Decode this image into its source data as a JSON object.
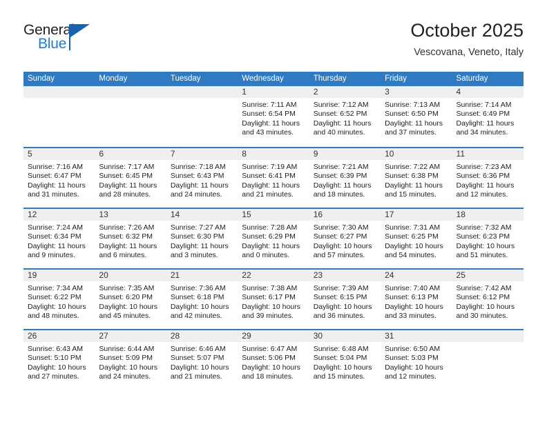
{
  "brand": {
    "word_one": "General",
    "word_two": "Blue",
    "logo_icon": "triangle-flag-icon",
    "color_dark": "#231f20",
    "color_blue": "#1a7fd4"
  },
  "header": {
    "title": "October 2025",
    "subtitle": "Vescovana, Veneto, Italy"
  },
  "theme": {
    "header_blue": "#2f7ac0",
    "daynum_band": "#efefef",
    "text": "#1d1d1d"
  },
  "calendar": {
    "weekday_headers": [
      "Sunday",
      "Monday",
      "Tuesday",
      "Wednesday",
      "Thursday",
      "Friday",
      "Saturday"
    ],
    "weeks": [
      [
        {
          "day": "",
          "lines": []
        },
        {
          "day": "",
          "lines": []
        },
        {
          "day": "",
          "lines": []
        },
        {
          "day": "1",
          "lines": [
            "Sunrise: 7:11 AM",
            "Sunset: 6:54 PM",
            "Daylight: 11 hours",
            "and 43 minutes."
          ]
        },
        {
          "day": "2",
          "lines": [
            "Sunrise: 7:12 AM",
            "Sunset: 6:52 PM",
            "Daylight: 11 hours",
            "and 40 minutes."
          ]
        },
        {
          "day": "3",
          "lines": [
            "Sunrise: 7:13 AM",
            "Sunset: 6:50 PM",
            "Daylight: 11 hours",
            "and 37 minutes."
          ]
        },
        {
          "day": "4",
          "lines": [
            "Sunrise: 7:14 AM",
            "Sunset: 6:49 PM",
            "Daylight: 11 hours",
            "and 34 minutes."
          ]
        }
      ],
      [
        {
          "day": "5",
          "lines": [
            "Sunrise: 7:16 AM",
            "Sunset: 6:47 PM",
            "Daylight: 11 hours",
            "and 31 minutes."
          ]
        },
        {
          "day": "6",
          "lines": [
            "Sunrise: 7:17 AM",
            "Sunset: 6:45 PM",
            "Daylight: 11 hours",
            "and 28 minutes."
          ]
        },
        {
          "day": "7",
          "lines": [
            "Sunrise: 7:18 AM",
            "Sunset: 6:43 PM",
            "Daylight: 11 hours",
            "and 24 minutes."
          ]
        },
        {
          "day": "8",
          "lines": [
            "Sunrise: 7:19 AM",
            "Sunset: 6:41 PM",
            "Daylight: 11 hours",
            "and 21 minutes."
          ]
        },
        {
          "day": "9",
          "lines": [
            "Sunrise: 7:21 AM",
            "Sunset: 6:39 PM",
            "Daylight: 11 hours",
            "and 18 minutes."
          ]
        },
        {
          "day": "10",
          "lines": [
            "Sunrise: 7:22 AM",
            "Sunset: 6:38 PM",
            "Daylight: 11 hours",
            "and 15 minutes."
          ]
        },
        {
          "day": "11",
          "lines": [
            "Sunrise: 7:23 AM",
            "Sunset: 6:36 PM",
            "Daylight: 11 hours",
            "and 12 minutes."
          ]
        }
      ],
      [
        {
          "day": "12",
          "lines": [
            "Sunrise: 7:24 AM",
            "Sunset: 6:34 PM",
            "Daylight: 11 hours",
            "and 9 minutes."
          ]
        },
        {
          "day": "13",
          "lines": [
            "Sunrise: 7:26 AM",
            "Sunset: 6:32 PM",
            "Daylight: 11 hours",
            "and 6 minutes."
          ]
        },
        {
          "day": "14",
          "lines": [
            "Sunrise: 7:27 AM",
            "Sunset: 6:30 PM",
            "Daylight: 11 hours",
            "and 3 minutes."
          ]
        },
        {
          "day": "15",
          "lines": [
            "Sunrise: 7:28 AM",
            "Sunset: 6:29 PM",
            "Daylight: 11 hours",
            "and 0 minutes."
          ]
        },
        {
          "day": "16",
          "lines": [
            "Sunrise: 7:30 AM",
            "Sunset: 6:27 PM",
            "Daylight: 10 hours",
            "and 57 minutes."
          ]
        },
        {
          "day": "17",
          "lines": [
            "Sunrise: 7:31 AM",
            "Sunset: 6:25 PM",
            "Daylight: 10 hours",
            "and 54 minutes."
          ]
        },
        {
          "day": "18",
          "lines": [
            "Sunrise: 7:32 AM",
            "Sunset: 6:23 PM",
            "Daylight: 10 hours",
            "and 51 minutes."
          ]
        }
      ],
      [
        {
          "day": "19",
          "lines": [
            "Sunrise: 7:34 AM",
            "Sunset: 6:22 PM",
            "Daylight: 10 hours",
            "and 48 minutes."
          ]
        },
        {
          "day": "20",
          "lines": [
            "Sunrise: 7:35 AM",
            "Sunset: 6:20 PM",
            "Daylight: 10 hours",
            "and 45 minutes."
          ]
        },
        {
          "day": "21",
          "lines": [
            "Sunrise: 7:36 AM",
            "Sunset: 6:18 PM",
            "Daylight: 10 hours",
            "and 42 minutes."
          ]
        },
        {
          "day": "22",
          "lines": [
            "Sunrise: 7:38 AM",
            "Sunset: 6:17 PM",
            "Daylight: 10 hours",
            "and 39 minutes."
          ]
        },
        {
          "day": "23",
          "lines": [
            "Sunrise: 7:39 AM",
            "Sunset: 6:15 PM",
            "Daylight: 10 hours",
            "and 36 minutes."
          ]
        },
        {
          "day": "24",
          "lines": [
            "Sunrise: 7:40 AM",
            "Sunset: 6:13 PM",
            "Daylight: 10 hours",
            "and 33 minutes."
          ]
        },
        {
          "day": "25",
          "lines": [
            "Sunrise: 7:42 AM",
            "Sunset: 6:12 PM",
            "Daylight: 10 hours",
            "and 30 minutes."
          ]
        }
      ],
      [
        {
          "day": "26",
          "lines": [
            "Sunrise: 6:43 AM",
            "Sunset: 5:10 PM",
            "Daylight: 10 hours",
            "and 27 minutes."
          ]
        },
        {
          "day": "27",
          "lines": [
            "Sunrise: 6:44 AM",
            "Sunset: 5:09 PM",
            "Daylight: 10 hours",
            "and 24 minutes."
          ]
        },
        {
          "day": "28",
          "lines": [
            "Sunrise: 6:46 AM",
            "Sunset: 5:07 PM",
            "Daylight: 10 hours",
            "and 21 minutes."
          ]
        },
        {
          "day": "29",
          "lines": [
            "Sunrise: 6:47 AM",
            "Sunset: 5:06 PM",
            "Daylight: 10 hours",
            "and 18 minutes."
          ]
        },
        {
          "day": "30",
          "lines": [
            "Sunrise: 6:48 AM",
            "Sunset: 5:04 PM",
            "Daylight: 10 hours",
            "and 15 minutes."
          ]
        },
        {
          "day": "31",
          "lines": [
            "Sunrise: 6:50 AM",
            "Sunset: 5:03 PM",
            "Daylight: 10 hours",
            "and 12 minutes."
          ]
        },
        {
          "day": "",
          "lines": []
        }
      ]
    ]
  }
}
